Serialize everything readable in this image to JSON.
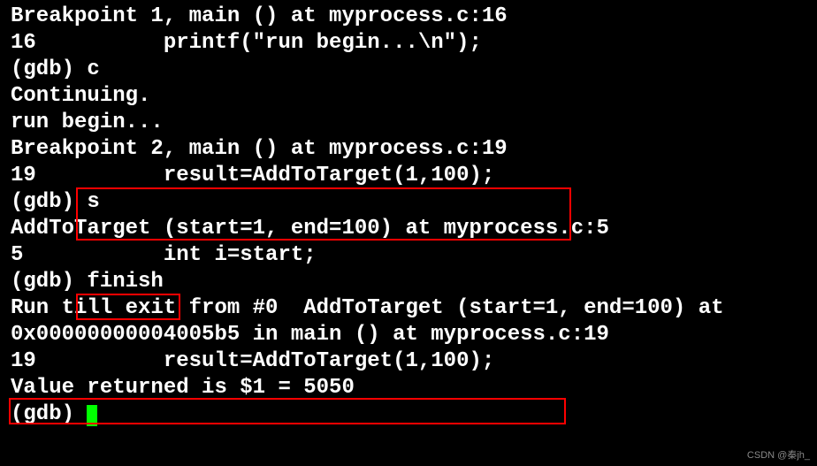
{
  "lines": {
    "l01": "Breakpoint 1, main () at myprocess.c:16",
    "l02": "16          printf(\"run begin...\\n\");",
    "l03": "(gdb) c",
    "l04": "Continuing.",
    "l05": "run begin...",
    "l06": "",
    "l07": "Breakpoint 2, main () at myprocess.c:19",
    "l08": "19          result=AddToTarget(1,100);",
    "l09": "(gdb) s",
    "l10": "AddToTarget (start=1, end=100) at myprocess.c:5",
    "l11": "5           int i=start;",
    "l12": "(gdb) finish",
    "l13": "Run till exit from #0  AddToTarget (start=1, end=100) at",
    "l14": "0x00000000004005b5 in main () at myprocess.c:19",
    "l15": "19          result=AddToTarget(1,100);",
    "l16": "Value returned is $1 = 5050",
    "l17": "(gdb) "
  },
  "watermark": "CSDN @秦jh_"
}
